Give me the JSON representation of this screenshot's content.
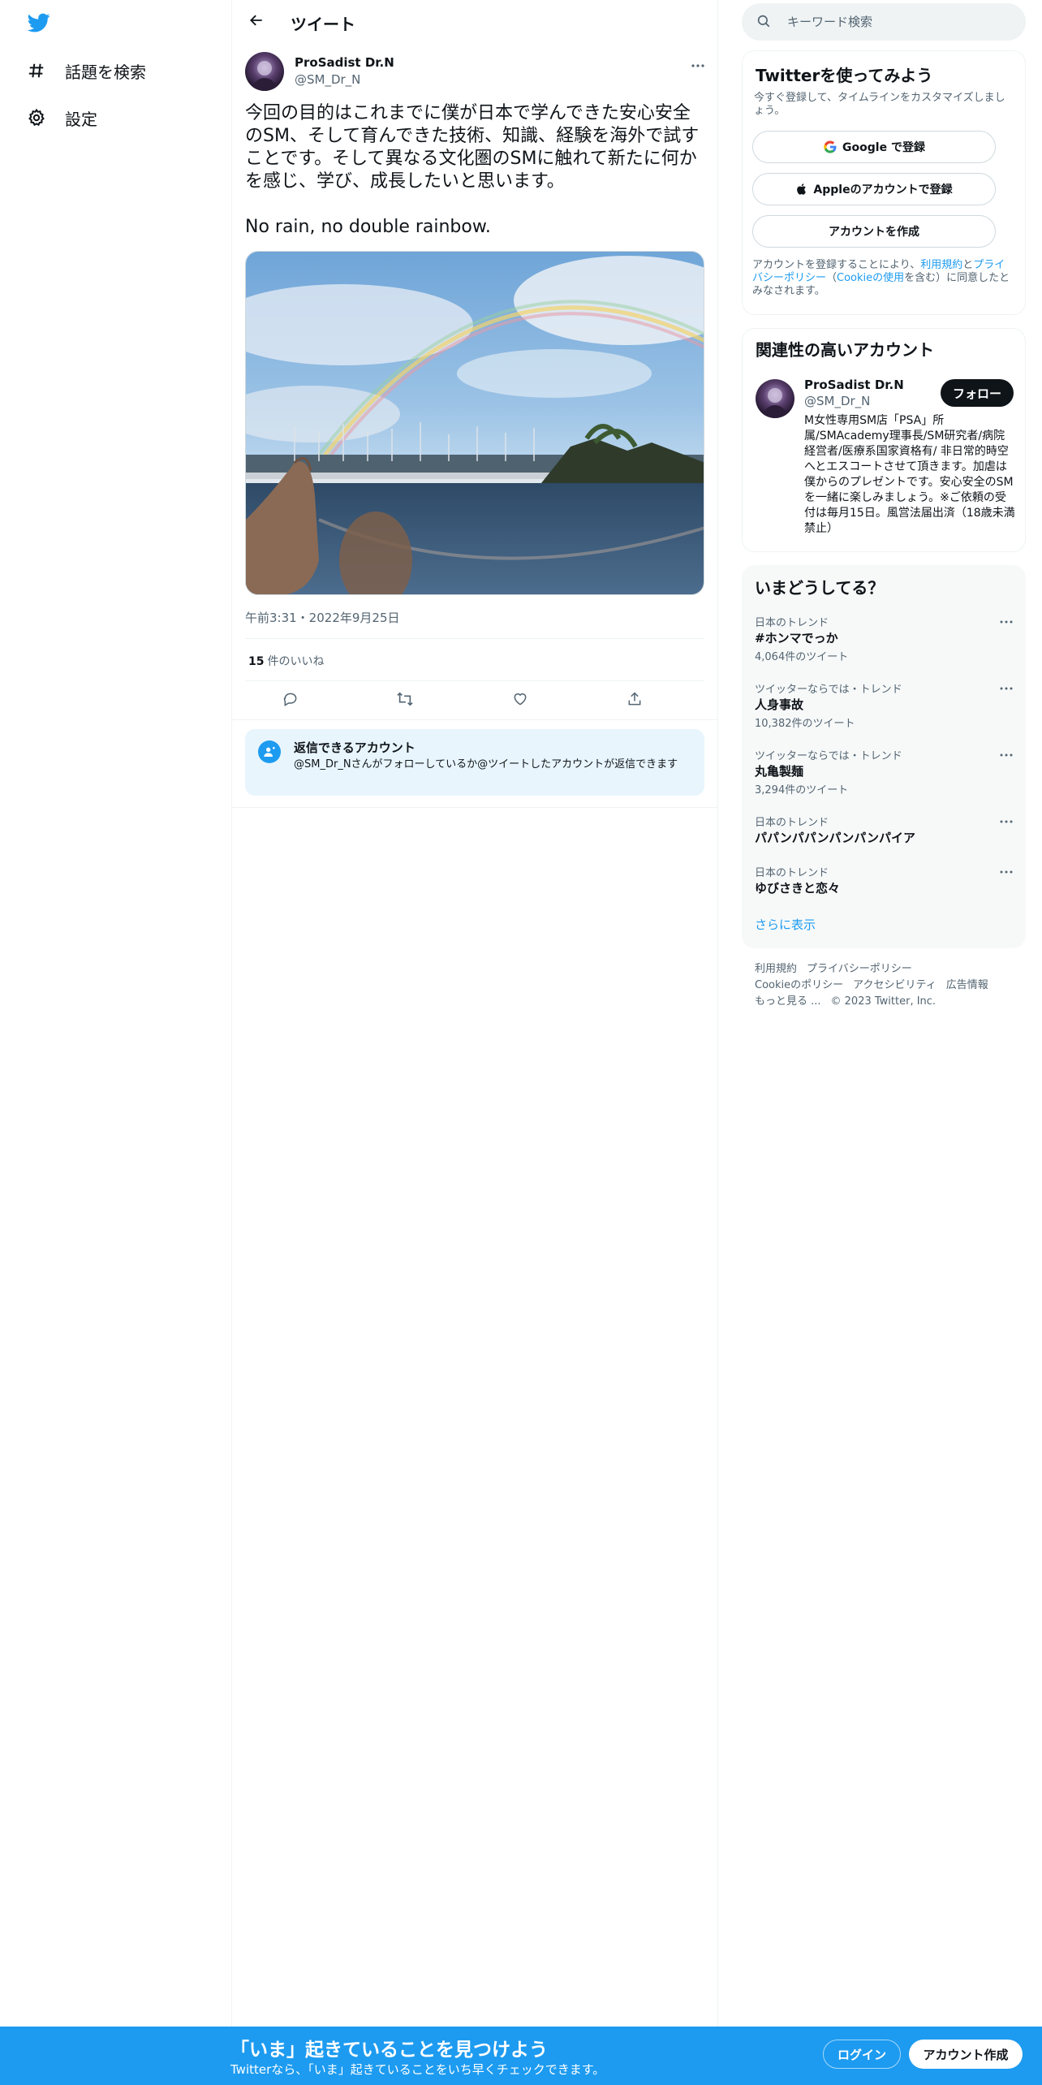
{
  "nav": {
    "logo": "twitter-bird-icon",
    "items": [
      {
        "icon": "hashtag-icon",
        "label": "話題を検索"
      },
      {
        "icon": "gear-icon",
        "label": "設定"
      }
    ]
  },
  "header": {
    "back_icon": "arrow-left-icon",
    "title": "ツイート"
  },
  "tweet": {
    "author_name": "ProSadist Dr.N",
    "author_handle": "@SM_Dr_N",
    "text": "今回の目的はこれまでに僕が日本で学んできた安心安全のSM、そして育んできた技術、知識、経験を海外で試すことです。そして異なる文化圏のSMに触れて新たに何かを感じ、学び、成長したいと思います。\n\nNo rain, no double rainbow.",
    "timestamp": "午前3:31・2022年9月25日",
    "likes_count": "15",
    "likes_label": "件のいいね",
    "actions": [
      "reply-icon",
      "retweet-icon",
      "like-icon",
      "share-icon"
    ]
  },
  "reply_notice": {
    "title": "返信できるアカウント",
    "description": "@SM_Dr_Nさんがフォローしているか@ツイートしたアカウントが返信できます"
  },
  "search": {
    "placeholder": "キーワード検索"
  },
  "signup_card": {
    "title": "Twitterを使ってみよう",
    "subtitle": "今すぐ登録して、タイムラインをカスタマイズしましょう。",
    "google_button": "Google で登録",
    "apple_button": "Appleのアカウントで登録",
    "create_button": "アカウントを作成",
    "terms_prefix": "アカウントを登録することにより、",
    "terms_link": "利用規約",
    "terms_and": "と",
    "privacy_link": "プライバシーポリシー",
    "cookie_open": "（",
    "cookie_link": "Cookieの使用",
    "terms_suffix": "を含む）に同意したとみなされます。"
  },
  "relevant": {
    "title": "関連性の高いアカウント",
    "name": "ProSadist Dr.N",
    "handle": "@SM_Dr_N",
    "follow_button": "フォロー",
    "bio": "M女性専用SM店「PSA」所属/SMAcademy理事長/SM研究者/病院経営者/医療系国家資格有/ 非日常的時空へとエスコートさせて頂きます。加虐は僕からのプレゼントです。安心安全のSMを一緒に楽しみましょう。※ご依頼の受付は毎月15日。風営法届出済（18歳未満禁止）"
  },
  "trends": {
    "title": "いまどうしてる？",
    "items": [
      {
        "context": "日本のトレンド",
        "name": "#ホンマでっか",
        "count": "4,064件のツイート"
      },
      {
        "context": "ツイッターならでは・トレンド",
        "name": "人身事故",
        "count": "10,382件のツイート"
      },
      {
        "context": "ツイッターならでは・トレンド",
        "name": "丸亀製麺",
        "count": "3,294件のツイート"
      },
      {
        "context": "日本のトレンド",
        "name": "パパンパパンパンパンパイア",
        "count": ""
      },
      {
        "context": "日本のトレンド",
        "name": "ゆびさきと恋々",
        "count": ""
      }
    ],
    "show_more": "さらに表示"
  },
  "footer": {
    "links": [
      "利用規約",
      "プライバシーポリシー",
      "Cookieのポリシー",
      "アクセシビリティ",
      "広告情報",
      "もっと見る ..."
    ],
    "copyright": "© 2023 Twitter, Inc."
  },
  "bottom_bar": {
    "title": "「いま」起きていることを見つけよう",
    "subtitle": "Twitterなら、「いま」起きていることをいち早くチェックできます。",
    "login_button": "ログイン",
    "signup_button": "アカウント作成"
  },
  "colors": {
    "brand": "#1d9bf0",
    "text": "#0f1419",
    "muted": "#536471"
  }
}
